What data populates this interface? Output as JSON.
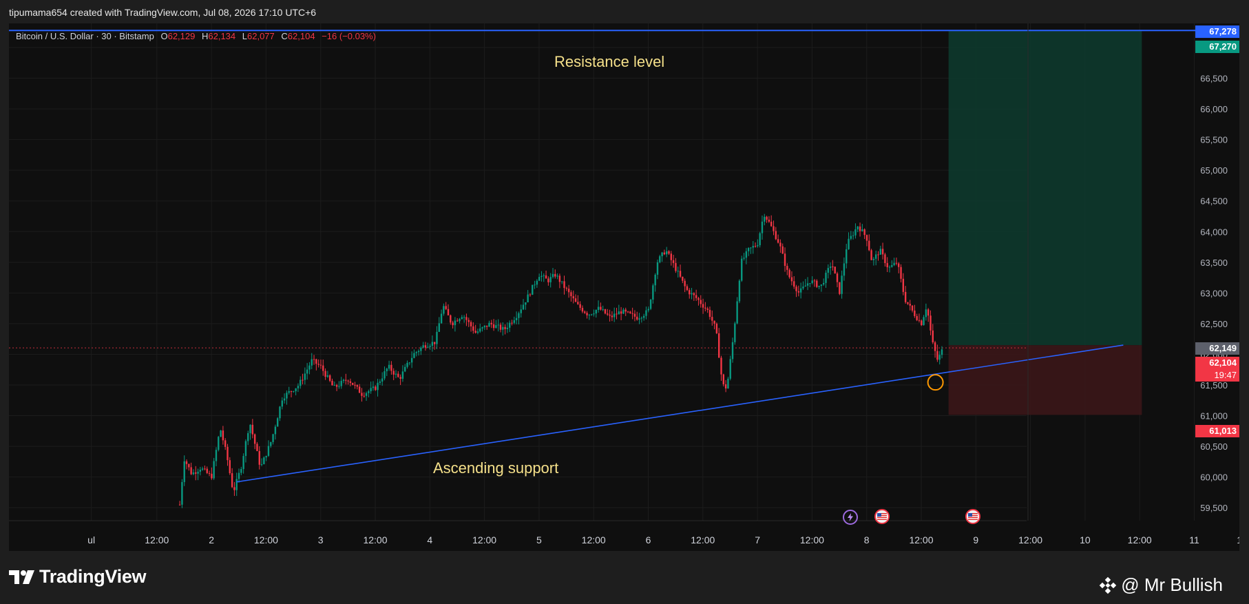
{
  "header": {
    "caption": "tipumama654 created with TradingView.com, Jul 08, 2026 17:10 UTC+6"
  },
  "legend": {
    "symbol": "Bitcoin / U.S. Dollar · 30 · Bitstamp",
    "o_label": "O",
    "o_value": "62,129",
    "h_label": "H",
    "h_value": "62,134",
    "l_label": "L",
    "l_value": "62,077",
    "c_label": "C",
    "c_value": "62,104",
    "change": "−16 (−0.03%)"
  },
  "annotations": {
    "resistance": "Resistance level",
    "support": "Ascending support"
  },
  "price_tags": {
    "resistance_top": "67,278",
    "target": "67,270",
    "entry": "62,149",
    "current": "62,104",
    "countdown": "19:47",
    "stop": "61,013"
  },
  "footer": {
    "brand": "TradingView",
    "author": "@ Mr Bullish"
  },
  "colors": {
    "up": "#089981",
    "down": "#f23645",
    "line": "#2962ff",
    "target_zone": "#0d3b2e",
    "stop_zone": "#3b1618",
    "annotation": "#f5e08a",
    "target_tag": "#089981",
    "resistance_tag": "#2962ff",
    "entry_tag": "#5d606b"
  },
  "chart_data": {
    "type": "candlestick",
    "symbol": "BTCUSD",
    "interval": "30",
    "exchange": "Bitstamp",
    "ylim": [
      59400,
      67400
    ],
    "y_ticks": [
      59500,
      60000,
      60500,
      61000,
      61500,
      62000,
      62500,
      63000,
      63500,
      64000,
      64500,
      65000,
      65500,
      66000,
      66500,
      67000
    ],
    "x_ticks": [
      {
        "label": "ul",
        "t": -0.1
      },
      {
        "label": "12:00",
        "t": 0.5
      },
      {
        "label": "2",
        "t": 1.0
      },
      {
        "label": "12:00",
        "t": 1.5
      },
      {
        "label": "3",
        "t": 2.0
      },
      {
        "label": "12:00",
        "t": 2.5
      },
      {
        "label": "4",
        "t": 3.0
      },
      {
        "label": "12:00",
        "t": 3.5
      },
      {
        "label": "5",
        "t": 4.0
      },
      {
        "label": "12:00",
        "t": 4.5
      },
      {
        "label": "6",
        "t": 5.0
      },
      {
        "label": "12:00",
        "t": 5.5
      },
      {
        "label": "7",
        "t": 6.0
      },
      {
        "label": "12:00",
        "t": 6.5
      },
      {
        "label": "8",
        "t": 7.0
      },
      {
        "label": "12:00",
        "t": 7.5
      },
      {
        "label": "9",
        "t": 8.0
      },
      {
        "label": "12:00",
        "t": 8.5
      },
      {
        "label": "10",
        "t": 9.0
      },
      {
        "label": "12:00",
        "t": 9.5
      },
      {
        "label": "11",
        "t": 10.0
      },
      {
        "label": "12:00",
        "t": 10.5
      }
    ],
    "close_path": [
      {
        "t": 0.71,
        "p": 59550
      },
      {
        "t": 0.75,
        "p": 60300
      },
      {
        "t": 0.82,
        "p": 60050
      },
      {
        "t": 0.9,
        "p": 60150
      },
      {
        "t": 1.0,
        "p": 60000
      },
      {
        "t": 1.08,
        "p": 60800
      },
      {
        "t": 1.14,
        "p": 60350
      },
      {
        "t": 1.2,
        "p": 59750
      },
      {
        "t": 1.27,
        "p": 60150
      },
      {
        "t": 1.35,
        "p": 60900
      },
      {
        "t": 1.45,
        "p": 60150
      },
      {
        "t": 1.55,
        "p": 60600
      },
      {
        "t": 1.65,
        "p": 61300
      },
      {
        "t": 1.8,
        "p": 61500
      },
      {
        "t": 1.92,
        "p": 61900
      },
      {
        "t": 2.0,
        "p": 61800
      },
      {
        "t": 2.12,
        "p": 61450
      },
      {
        "t": 2.25,
        "p": 61600
      },
      {
        "t": 2.38,
        "p": 61350
      },
      {
        "t": 2.5,
        "p": 61450
      },
      {
        "t": 2.62,
        "p": 61800
      },
      {
        "t": 2.72,
        "p": 61600
      },
      {
        "t": 2.85,
        "p": 62000
      },
      {
        "t": 2.95,
        "p": 62150
      },
      {
        "t": 3.05,
        "p": 62200
      },
      {
        "t": 3.12,
        "p": 62800
      },
      {
        "t": 3.2,
        "p": 62500
      },
      {
        "t": 3.3,
        "p": 62650
      },
      {
        "t": 3.42,
        "p": 62350
      },
      {
        "t": 3.55,
        "p": 62500
      },
      {
        "t": 3.68,
        "p": 62400
      },
      {
        "t": 3.8,
        "p": 62650
      },
      {
        "t": 3.9,
        "p": 62950
      },
      {
        "t": 4.0,
        "p": 63300
      },
      {
        "t": 4.08,
        "p": 63200
      },
      {
        "t": 4.15,
        "p": 63300
      },
      {
        "t": 4.25,
        "p": 63050
      },
      {
        "t": 4.35,
        "p": 62800
      },
      {
        "t": 4.45,
        "p": 62650
      },
      {
        "t": 4.55,
        "p": 62750
      },
      {
        "t": 4.65,
        "p": 62600
      },
      {
        "t": 4.75,
        "p": 62700
      },
      {
        "t": 4.9,
        "p": 62600
      },
      {
        "t": 5.0,
        "p": 62700
      },
      {
        "t": 5.08,
        "p": 63500
      },
      {
        "t": 5.16,
        "p": 63700
      },
      {
        "t": 5.25,
        "p": 63400
      },
      {
        "t": 5.35,
        "p": 63050
      },
      {
        "t": 5.45,
        "p": 62900
      },
      {
        "t": 5.55,
        "p": 62700
      },
      {
        "t": 5.62,
        "p": 62400
      },
      {
        "t": 5.68,
        "p": 61500
      },
      {
        "t": 5.72,
        "p": 61450
      },
      {
        "t": 5.78,
        "p": 62300
      },
      {
        "t": 5.85,
        "p": 63500
      },
      {
        "t": 5.92,
        "p": 63700
      },
      {
        "t": 6.0,
        "p": 63800
      },
      {
        "t": 6.06,
        "p": 64300
      },
      {
        "t": 6.12,
        "p": 64100
      },
      {
        "t": 6.2,
        "p": 63800
      },
      {
        "t": 6.28,
        "p": 63300
      },
      {
        "t": 6.38,
        "p": 63000
      },
      {
        "t": 6.48,
        "p": 63200
      },
      {
        "t": 6.58,
        "p": 63100
      },
      {
        "t": 6.68,
        "p": 63500
      },
      {
        "t": 6.75,
        "p": 63000
      },
      {
        "t": 6.82,
        "p": 63800
      },
      {
        "t": 6.92,
        "p": 64100
      },
      {
        "t": 7.0,
        "p": 63900
      },
      {
        "t": 7.05,
        "p": 63500
      },
      {
        "t": 7.12,
        "p": 63700
      },
      {
        "t": 7.2,
        "p": 63400
      },
      {
        "t": 7.28,
        "p": 63500
      },
      {
        "t": 7.35,
        "p": 62900
      },
      {
        "t": 7.42,
        "p": 62700
      },
      {
        "t": 7.5,
        "p": 62500
      },
      {
        "t": 7.55,
        "p": 62800
      },
      {
        "t": 7.6,
        "p": 62200
      },
      {
        "t": 7.65,
        "p": 61900
      },
      {
        "t": 7.7,
        "p": 62100
      }
    ],
    "resistance_price": 67278,
    "support_line": {
      "from": {
        "t": 1.23,
        "p": 59920
      },
      "to": {
        "t": 9.35,
        "p": 62150
      }
    },
    "position": {
      "t_start": 7.75,
      "t_end": 9.52,
      "target": 67270,
      "entry": 62149,
      "stop": 61013
    },
    "current_price": 62104,
    "marker": {
      "t": 7.63,
      "p": 61700
    }
  }
}
